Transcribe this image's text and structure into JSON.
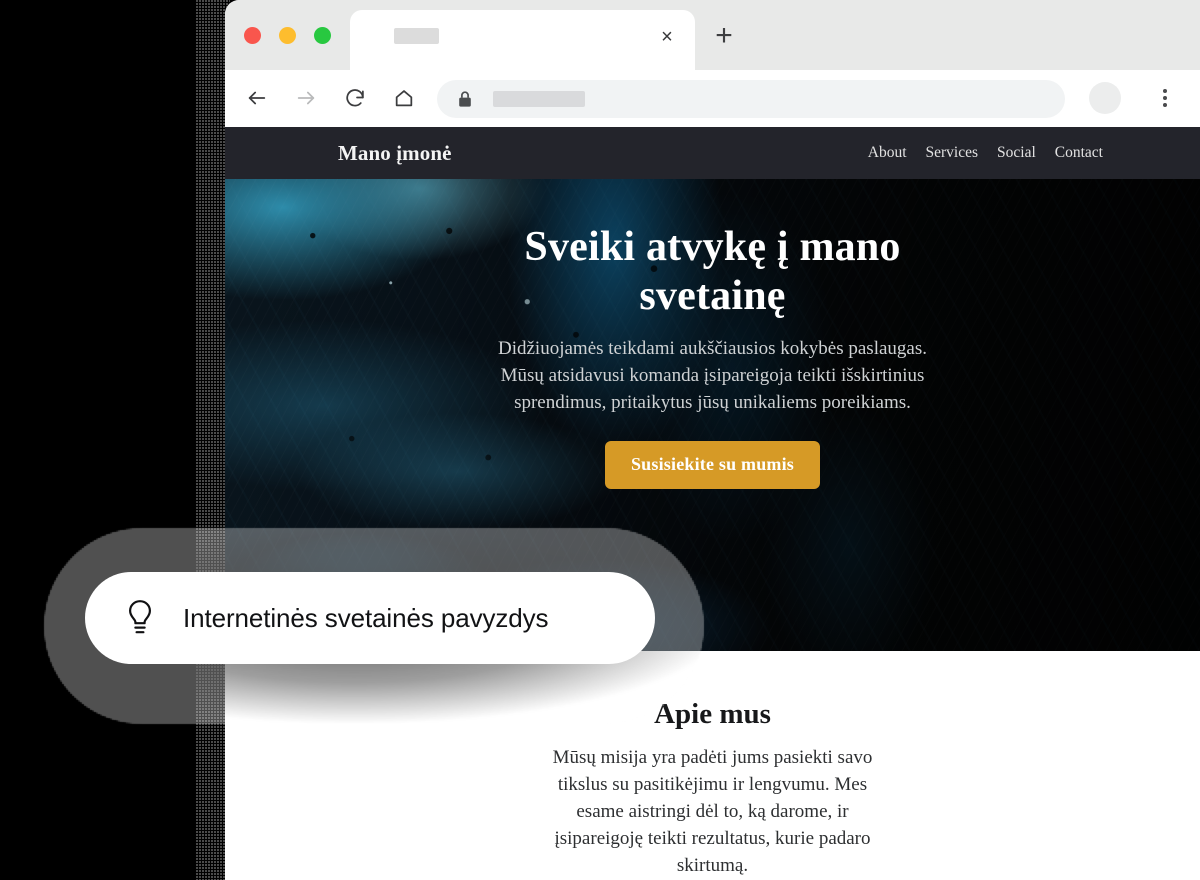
{
  "browser": {
    "traffic_lights": [
      {
        "name": "close",
        "color": "#f9564d"
      },
      {
        "name": "minimize",
        "color": "#fdbd2e"
      },
      {
        "name": "zoom",
        "color": "#28c840"
      }
    ],
    "tab": {
      "title": "",
      "close_label": "×"
    },
    "new_tab_label": "+",
    "toolbar": {
      "back_label": "back-arrow",
      "forward_label": "forward-arrow",
      "reload_label": "reload-arrow",
      "home_label": "home",
      "lock_label": "lock",
      "url_value": "",
      "menu_label": "kebab-menu"
    }
  },
  "site": {
    "brand": "Mano įmonė",
    "nav_links": [
      {
        "label": "About"
      },
      {
        "label": "Services"
      },
      {
        "label": "Social"
      },
      {
        "label": "Contact"
      }
    ],
    "nav_background": "#23242b",
    "hero": {
      "title": "Sveiki atvykę į mano svetainę",
      "subtitle": "Didžiuojamės teikdami aukščiausios kokybės paslaugas. Mūsų atsidavusi komanda įsipareigoja teikti išskirtinius sprendimus, pritaikytus jūsų unikaliems poreikiams.",
      "cta_label": "Susisiekite su mumis",
      "cta_color": "#d69a26",
      "background_description": "dark blue abstract fluid ink texture"
    },
    "about": {
      "title": "Apie mus",
      "text": "Mūsų misija yra padėti jums pasiekti savo tikslus su pasitikėjimu ir lengvumu. Mes esame aistringi dėl to, ką darome, ir įsipareigoję teikti rezultatus, kurie padaro skirtumą."
    }
  },
  "tooltip": {
    "icon": "lightbulb-icon",
    "label": "Internetinės svetainės pavyzdys"
  }
}
